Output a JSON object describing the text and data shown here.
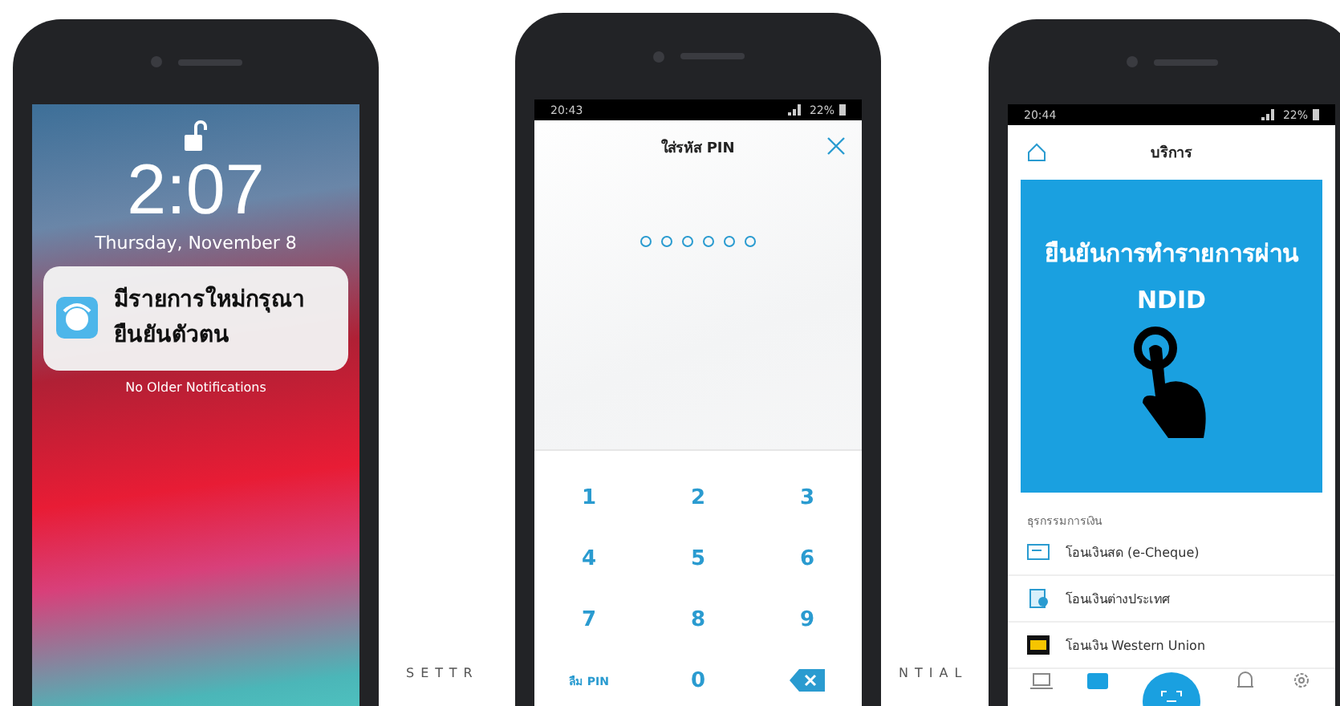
{
  "lock_screen": {
    "time": "2:07",
    "date": "Thursday, November 8",
    "notification": {
      "message": "มีรายการใหม่กรุณา\nยืนยันตัวตน"
    },
    "footer_note": "No Older Notifications"
  },
  "pin_screen": {
    "status_time": "20:43",
    "battery": "22%",
    "title": "ใส่รหัส PIN",
    "pin_dots": [
      {
        "filled": false
      },
      {
        "filled": false
      },
      {
        "filled": false
      },
      {
        "filled": false
      },
      {
        "filled": false
      },
      {
        "filled": false
      }
    ],
    "keys": [
      {
        "kind": "digit",
        "label": "1"
      },
      {
        "kind": "digit",
        "label": "2"
      },
      {
        "kind": "digit",
        "label": "3"
      },
      {
        "kind": "digit",
        "label": "4"
      },
      {
        "kind": "digit",
        "label": "5"
      },
      {
        "kind": "digit",
        "label": "6"
      },
      {
        "kind": "digit",
        "label": "7"
      },
      {
        "kind": "digit",
        "label": "8"
      },
      {
        "kind": "digit",
        "label": "9"
      },
      {
        "kind": "text",
        "label": "ลืม PIN"
      },
      {
        "kind": "digit",
        "label": "0"
      },
      {
        "kind": "backspace"
      }
    ]
  },
  "services_screen": {
    "status_time": "20:44",
    "battery": "22%",
    "title": "บริการ",
    "banner": {
      "text": "ยืนยันการทำรายการผ่าน\nNDID"
    },
    "section_title": "ธุรกรรมการเงิน",
    "items": [
      {
        "kind": "cheque",
        "label": "โอนเงินสด (e-Cheque)"
      },
      {
        "kind": "transfer",
        "label": "โอนเงินต่างประเทศ"
      },
      {
        "kind": "western-union",
        "label": "โอนเงิน Western Union"
      }
    ],
    "nav": [
      {
        "kind": "laptop",
        "selected": false
      },
      {
        "kind": "wallet",
        "selected": true
      },
      {
        "kind": "scan",
        "selected": false
      },
      {
        "kind": "bell",
        "selected": false
      },
      {
        "kind": "gear",
        "selected": false
      }
    ]
  },
  "background_text": [
    {
      "text": "SETTR"
    },
    {
      "text": "NTIAL"
    }
  ]
}
